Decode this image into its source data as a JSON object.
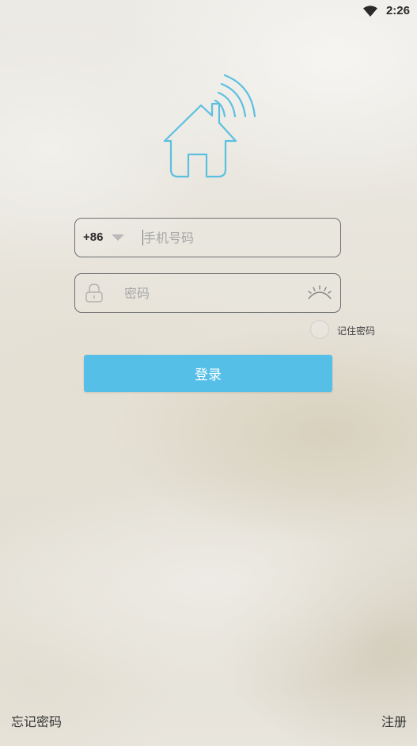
{
  "status_bar": {
    "time": "2:26",
    "wifi_icon": "wifi-icon"
  },
  "logo": {
    "icon": "house-wifi-icon",
    "color": "#5bc0e0"
  },
  "phone": {
    "country_code": "+86",
    "placeholder": "手机号码",
    "dropdown_icon": "caret-down-icon"
  },
  "password": {
    "placeholder": "密码",
    "lock_icon": "lock-icon",
    "visibility_icon": "eye-closed-icon"
  },
  "remember": {
    "label": "记住密码",
    "checked": false
  },
  "login": {
    "label": "登录",
    "color": "#55bfe7"
  },
  "footer": {
    "forgot_label": "忘记密码",
    "register_label": "注册"
  }
}
